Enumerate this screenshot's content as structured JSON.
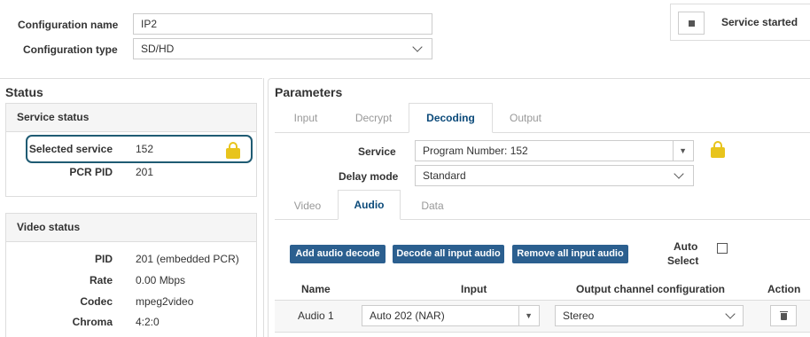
{
  "config": {
    "name_label": "Configuration name",
    "name_value": "IP2",
    "type_label": "Configuration type",
    "type_value": "SD/HD"
  },
  "service_state": {
    "label": "Service started"
  },
  "status": {
    "title": "Status",
    "service_status": {
      "title": "Service status",
      "selected_label": "Selected service",
      "selected_value": "152",
      "pcr_label": "PCR PID",
      "pcr_value": "201"
    },
    "video_status": {
      "title": "Video status",
      "rows": [
        {
          "label": "PID",
          "value": "201 (embedded PCR)"
        },
        {
          "label": "Rate",
          "value": "0.00 Mbps"
        },
        {
          "label": "Codec",
          "value": "mpeg2video"
        },
        {
          "label": "Chroma",
          "value": "4:2:0"
        }
      ]
    }
  },
  "parameters": {
    "title": "Parameters",
    "tabs": [
      "Input",
      "Decrypt",
      "Decoding",
      "Output"
    ],
    "active_tab": "Decoding",
    "service_label": "Service",
    "service_value": "Program Number: 152",
    "delay_label": "Delay mode",
    "delay_value": "Standard",
    "subtabs": [
      "Video",
      "Audio",
      "Data"
    ],
    "active_subtab": "Audio",
    "buttons": {
      "add": "Add audio decode",
      "decode_all": "Decode all input audio",
      "remove_all": "Remove all input audio"
    },
    "auto_select_label_1": "Auto",
    "auto_select_label_2": "Select",
    "table": {
      "headers": {
        "name": "Name",
        "input": "Input",
        "output": "Output channel configuration",
        "action": "Action"
      },
      "rows": [
        {
          "name": "Audio 1",
          "input": "Auto 202 (NAR)",
          "output": "Stereo"
        }
      ]
    }
  },
  "colors": {
    "accent": "#2b5f8f",
    "lock": "#e8c41c",
    "highlight_border": "#1f5b73"
  }
}
